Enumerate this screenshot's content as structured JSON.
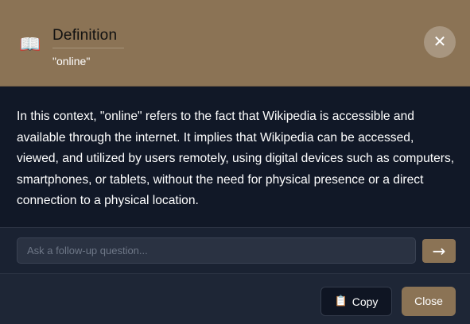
{
  "header": {
    "icon": "book-icon",
    "title": "Definition",
    "term": "\"online\"",
    "close_symbol": "✕"
  },
  "definition": {
    "text": "In this context, \"online\" refers to the fact that Wikipedia is accessible and available through the internet. It implies that Wikipedia can be accessed, viewed, and utilized by users remotely, using digital devices such as computers, smartphones, or tablets, without the need for physical presence or a direct connection to a physical location."
  },
  "followup": {
    "placeholder": "Ask a follow-up question...",
    "value": "",
    "send_symbol": "→"
  },
  "footer": {
    "copy_icon": "clipboard-icon",
    "copy_label": "Copy",
    "close_label": "Close"
  },
  "colors": {
    "accent": "#8b7355",
    "background": "#111827"
  }
}
